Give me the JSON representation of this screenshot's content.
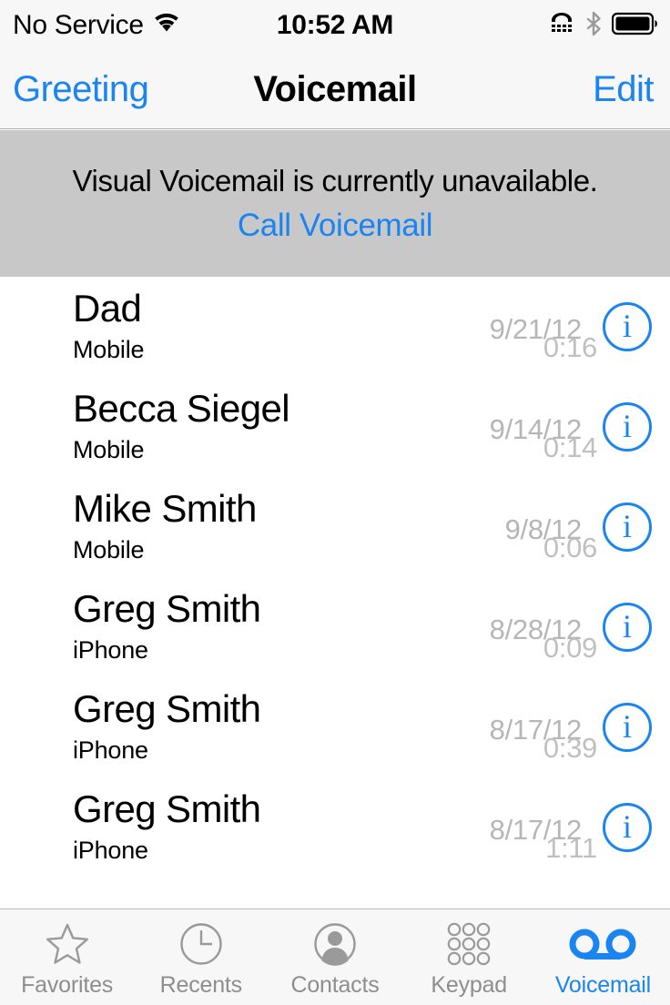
{
  "status_bar": {
    "carrier": "No Service",
    "wifi_icon": "wifi-icon",
    "time": "10:52 AM",
    "tty_icon": "tty-icon",
    "bluetooth_icon": "bluetooth-icon",
    "battery_icon": "battery-full-icon"
  },
  "nav_bar": {
    "left_button": "Greeting",
    "title": "Voicemail",
    "right_button": "Edit"
  },
  "banner": {
    "message": "Visual Voicemail is currently unavailable.",
    "action_link": "Call Voicemail"
  },
  "voicemails": [
    {
      "name": "Dad",
      "label": "Mobile",
      "date": "9/21/12",
      "duration": "0:16",
      "info": "i"
    },
    {
      "name": "Becca Siegel",
      "label": "Mobile",
      "date": "9/14/12",
      "duration": "0:14",
      "info": "i"
    },
    {
      "name": "Mike Smith",
      "label": "Mobile",
      "date": "9/8/12",
      "duration": "0:06",
      "info": "i"
    },
    {
      "name": "Greg Smith",
      "label": "iPhone",
      "date": "8/28/12",
      "duration": "0:09",
      "info": "i"
    },
    {
      "name": "Greg Smith",
      "label": "iPhone",
      "date": "8/17/12",
      "duration": "0:39",
      "info": "i"
    },
    {
      "name": "Greg Smith",
      "label": "iPhone",
      "date": "8/17/12",
      "duration": "1:11",
      "info": "i"
    }
  ],
  "tab_bar": {
    "tabs": [
      {
        "label": "Favorites",
        "icon": "star-icon",
        "active": false
      },
      {
        "label": "Recents",
        "icon": "clock-icon",
        "active": false
      },
      {
        "label": "Contacts",
        "icon": "person-icon",
        "active": false
      },
      {
        "label": "Keypad",
        "icon": "keypad-icon",
        "active": false
      },
      {
        "label": "Voicemail",
        "icon": "voicemail-icon",
        "active": true
      }
    ]
  },
  "colors": {
    "accent_blue": "#1a84f0",
    "banner_gray": "#c8c8c8",
    "bar_gray": "#f7f7f7",
    "inactive_gray": "#8e8e8e",
    "meta_gray": "#b6b6b6"
  }
}
